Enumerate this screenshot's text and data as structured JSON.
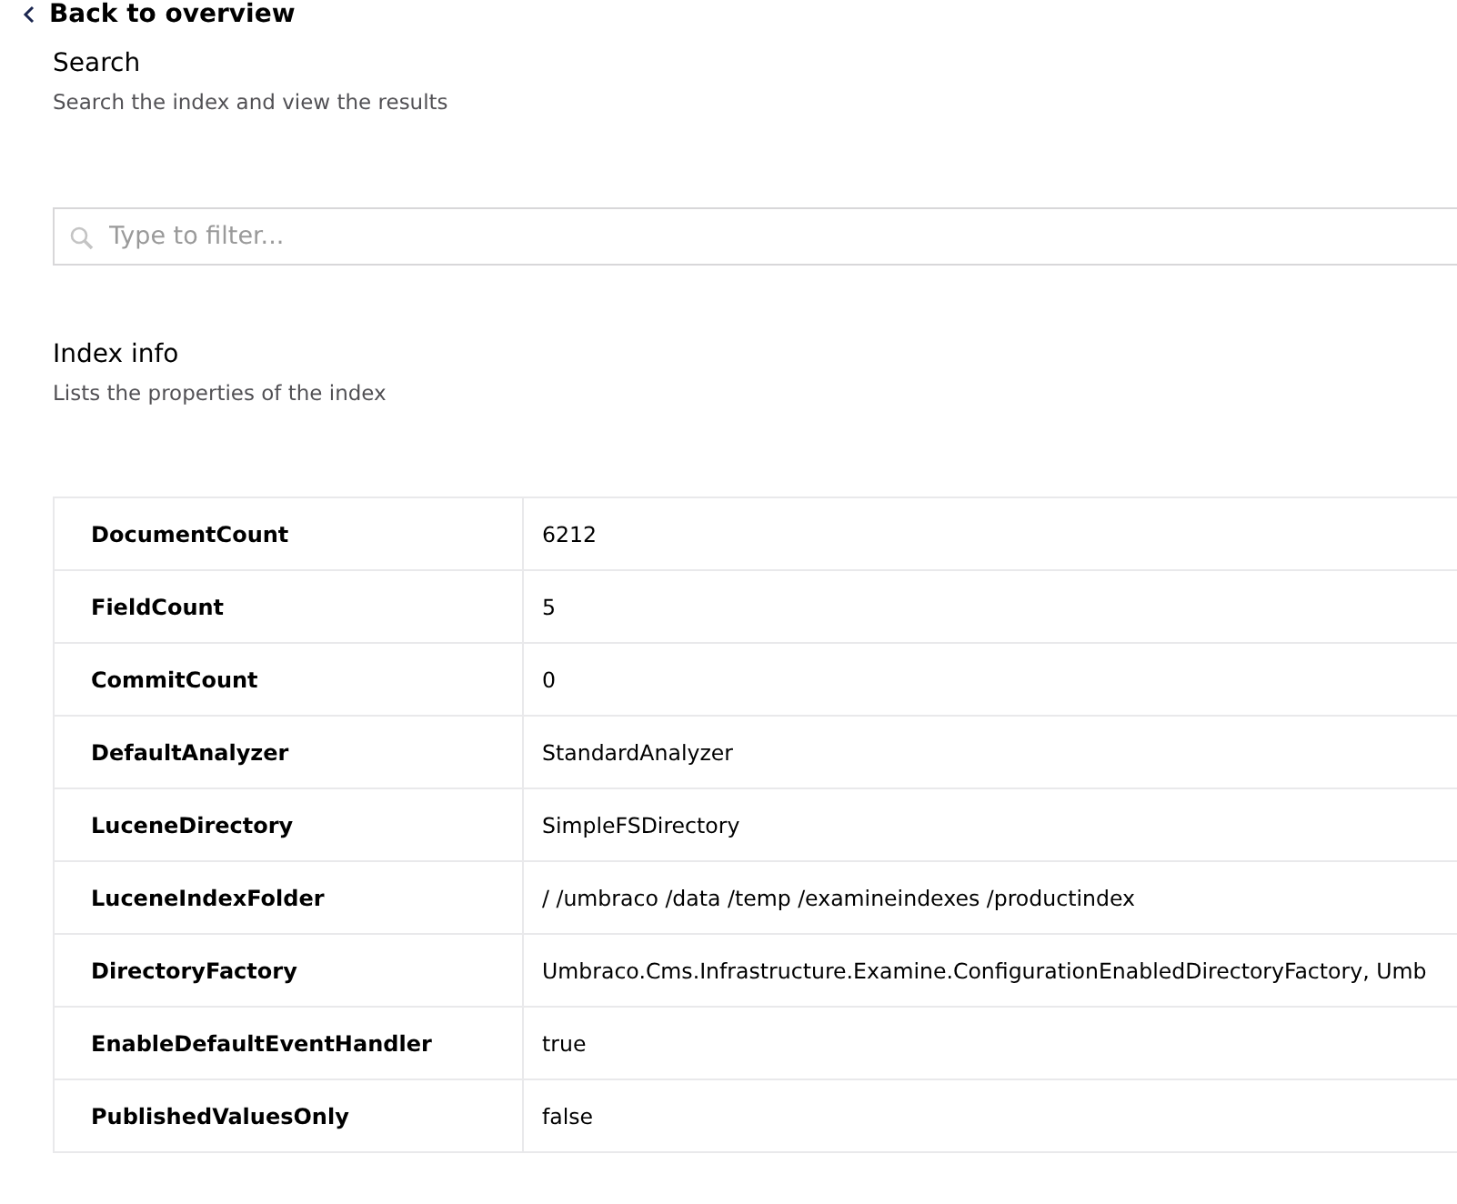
{
  "back_link": {
    "label": "Back to overview"
  },
  "search_section": {
    "title": "Search",
    "description": "Search the index and view the results",
    "filter": {
      "placeholder": "Type to filter..."
    }
  },
  "index_info": {
    "title": "Index info",
    "description": "Lists the properties of the index",
    "rows": [
      {
        "property": "DocumentCount",
        "value": "6212"
      },
      {
        "property": "FieldCount",
        "value": "5"
      },
      {
        "property": "CommitCount",
        "value": "0"
      },
      {
        "property": "DefaultAnalyzer",
        "value": "StandardAnalyzer"
      },
      {
        "property": "LuceneDirectory",
        "value": "SimpleFSDirectory"
      },
      {
        "property": "LuceneIndexFolder",
        "value": "/ /umbraco /data /temp /examineindexes /productindex"
      },
      {
        "property": "DirectoryFactory",
        "value": "Umbraco.Cms.Infrastructure.Examine.ConfigurationEnabledDirectoryFactory, Umb"
      },
      {
        "property": "EnableDefaultEventHandler",
        "value": "true"
      },
      {
        "property": "PublishedValuesOnly",
        "value": "false"
      }
    ]
  }
}
